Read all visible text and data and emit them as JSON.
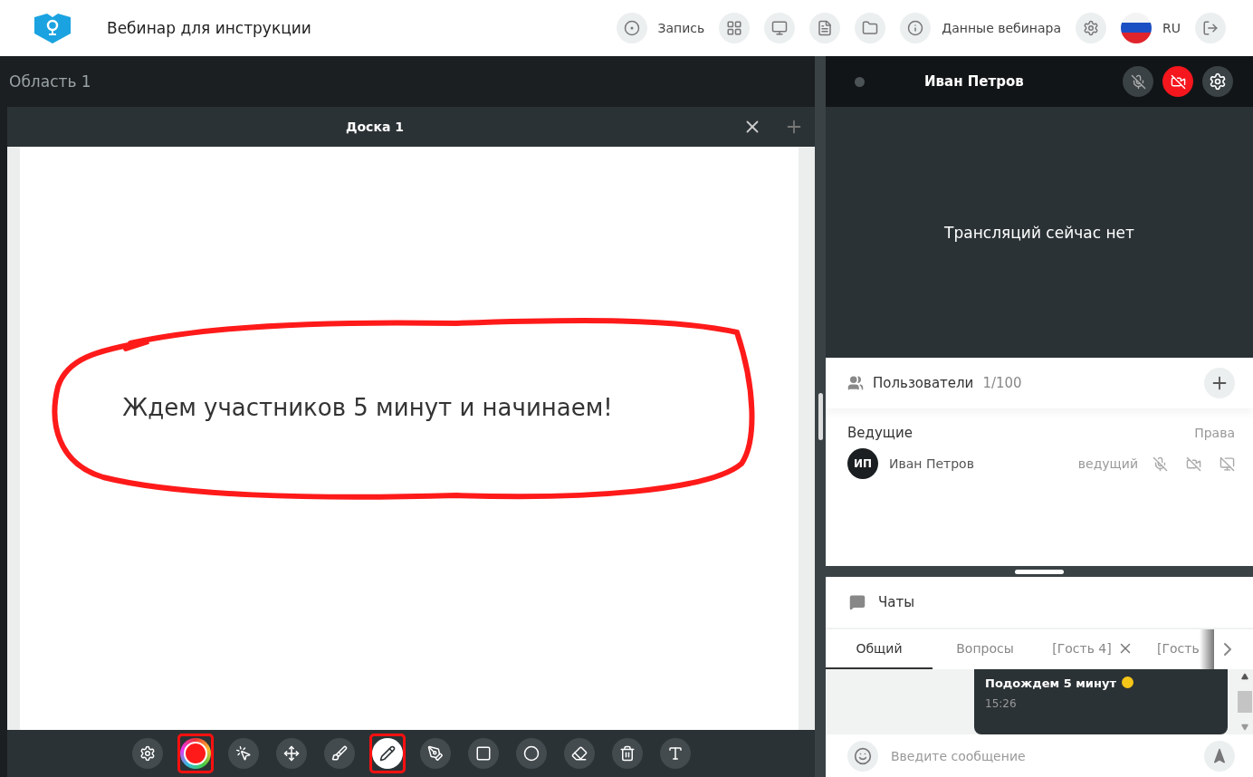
{
  "header": {
    "title": "Вебинар для инструкции",
    "items": [
      {
        "kind": "record",
        "label": "Запись"
      },
      {
        "kind": "grid"
      },
      {
        "kind": "screen"
      },
      {
        "kind": "document"
      },
      {
        "kind": "folder"
      },
      {
        "kind": "info",
        "label": "Данные вебинара"
      },
      {
        "kind": "settings"
      },
      {
        "kind": "flag",
        "label": "RU"
      },
      {
        "kind": "exit"
      }
    ]
  },
  "area": {
    "title": "Область 1",
    "tabs": [
      {
        "label": "Доска 1"
      }
    ]
  },
  "board": {
    "text": "Ждем участников 5 минут и начинаем!"
  },
  "tools": [
    {
      "kind": "settings",
      "selected": false,
      "highlighted": false
    },
    {
      "kind": "color",
      "color": "#ff1a1a",
      "highlighted": true
    },
    {
      "kind": "pointer",
      "selected": false,
      "highlighted": false
    },
    {
      "kind": "move",
      "selected": false,
      "highlighted": false
    },
    {
      "kind": "brush",
      "selected": false,
      "highlighted": false
    },
    {
      "kind": "pencil",
      "selected": true,
      "highlighted": true
    },
    {
      "kind": "pen",
      "selected": false,
      "highlighted": false
    },
    {
      "kind": "rectangle",
      "selected": false,
      "highlighted": false
    },
    {
      "kind": "circle",
      "selected": false,
      "highlighted": false
    },
    {
      "kind": "eraser",
      "selected": false,
      "highlighted": false
    },
    {
      "kind": "trash",
      "selected": false,
      "highlighted": false
    },
    {
      "kind": "text",
      "selected": false,
      "highlighted": false
    }
  ],
  "video": {
    "name": "Иван Петров",
    "mic_muted": true,
    "camera_off": true,
    "message": "Трансляций сейчас нет"
  },
  "users": {
    "title": "Пользователи",
    "count": "1/100",
    "group": "Ведущие",
    "rights": "Права",
    "members": [
      {
        "initials": "ИП",
        "name": "Иван Петров",
        "role": "ведущий"
      }
    ]
  },
  "chats": {
    "title": "Чаты",
    "tabs": [
      {
        "label": "Общий",
        "selected": true,
        "closable": false
      },
      {
        "label": "Вопросы",
        "selected": false,
        "closable": false
      },
      {
        "label": "[Гость 4]",
        "selected": false,
        "closable": true
      },
      {
        "label": "[Гость",
        "selected": false,
        "closable": false
      }
    ],
    "messages": [
      {
        "text": "Подождем 5 минут",
        "time": "15:26"
      }
    ],
    "input": {
      "placeholder": "Введите сообщение"
    }
  }
}
